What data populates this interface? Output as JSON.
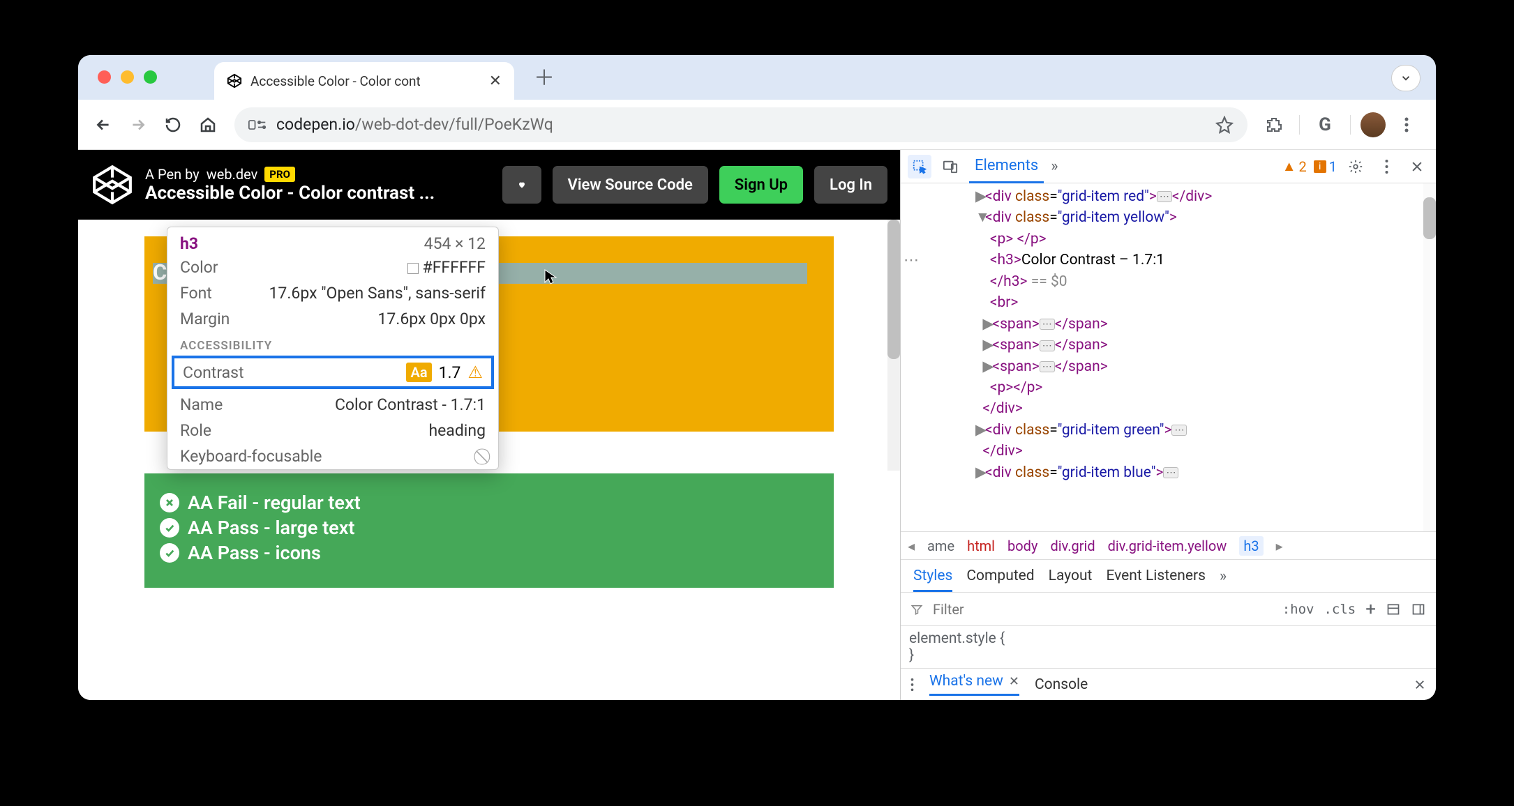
{
  "browser": {
    "tab_title": "Accessible Color - Color cont",
    "url_host": "codepen.io",
    "url_path": "/web-dot-dev/full/PoeKzWq"
  },
  "codepen": {
    "by_prefix": "A Pen by",
    "by_author": "web.dev",
    "pro_badge": "PRO",
    "title": "Accessible Color - Color contrast ...",
    "btn_source": "View Source Code",
    "btn_signup": "Sign Up",
    "btn_login": "Log In"
  },
  "demo": {
    "heading": "Color Contrast - 1.7:1",
    "lines": [
      {
        "status": "fail",
        "text": "AA Fail - regular text"
      },
      {
        "status": "pass",
        "text": "AA Pass - large text"
      },
      {
        "status": "pass",
        "text": "AA Pass - icons"
      }
    ]
  },
  "inspector": {
    "tag": "h3",
    "dimensions": "454 × 12",
    "rows": [
      {
        "label": "Color",
        "value": "#FFFFFF"
      },
      {
        "label": "Font",
        "value": "17.6px \"Open Sans\", sans-serif"
      },
      {
        "label": "Margin",
        "value": "17.6px 0px 0px"
      }
    ],
    "section": "ACCESSIBILITY",
    "contrast_label": "Contrast",
    "contrast_badge": "Aa",
    "contrast_value": "1.7",
    "a11y_rows": [
      {
        "label": "Name",
        "value": "Color Contrast - 1.7:1"
      },
      {
        "label": "Role",
        "value": "heading"
      },
      {
        "label": "Keyboard-focusable",
        "value": ""
      }
    ]
  },
  "devtools": {
    "tabs": {
      "elements": "Elements"
    },
    "issues_warn": "2",
    "issues_info": "1",
    "dom_h3_text": "Color Contrast – 1.7:1",
    "eq0": "== $0",
    "crumbs": [
      "ame",
      "html",
      "body",
      "div.grid",
      "div.grid-item.yellow",
      "h3"
    ],
    "mid_tabs": [
      "Styles",
      "Computed",
      "Layout",
      "Event Listeners"
    ],
    "filter_placeholder": "Filter",
    "hov": ":hov",
    "cls": ".cls",
    "element_style_open": "element.style {",
    "element_style_close": "}",
    "drawer": {
      "whatsnew": "What's new",
      "console": "Console"
    }
  }
}
